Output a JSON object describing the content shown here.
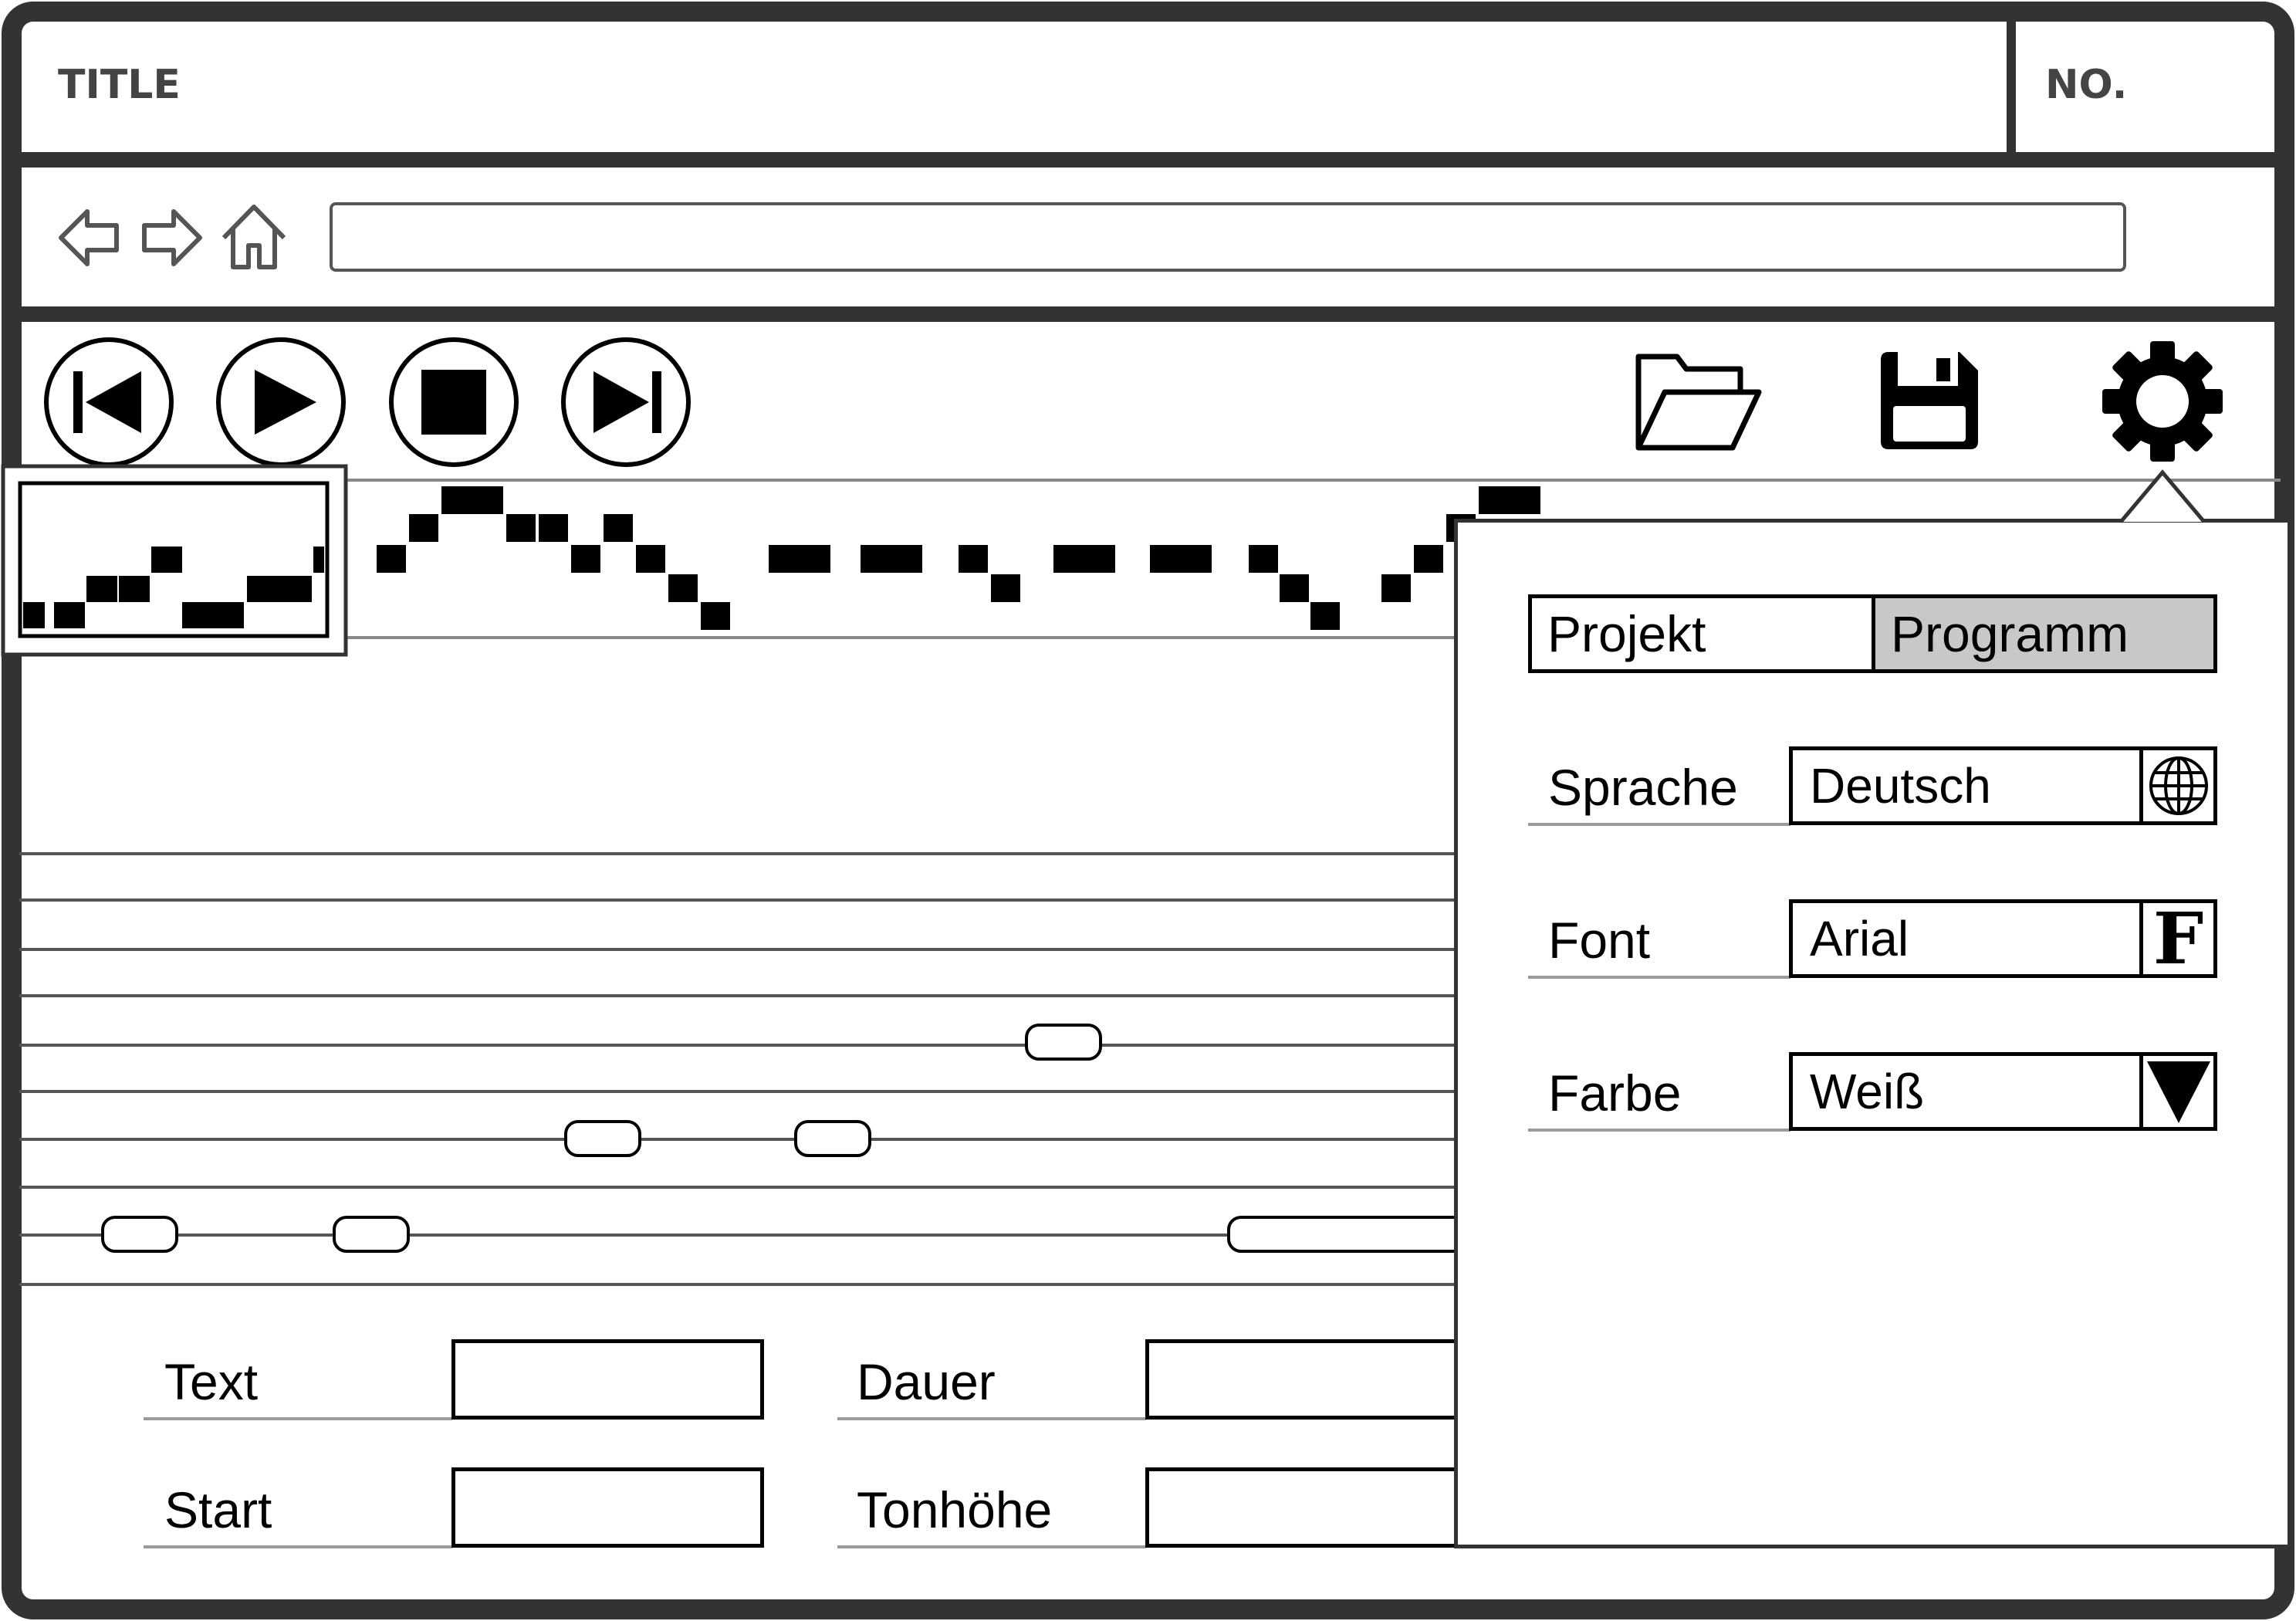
{
  "window": {
    "title": "TITLE",
    "number_label": "NO."
  },
  "navbar": {
    "back_icon": "arrow-left-outline-icon",
    "forward_icon": "arrow-right-outline-icon",
    "home_icon": "house-outline-icon",
    "address_value": ""
  },
  "toolbar": {
    "transport": [
      "skip-back-icon",
      "play-icon",
      "stop-icon",
      "skip-forward-icon"
    ],
    "actions": [
      "folder-open-icon",
      "save-disk-icon",
      "gear-icon"
    ]
  },
  "editor": {
    "fields": {
      "text_label": "Text",
      "text_value": "",
      "start_label": "Start",
      "start_value": "",
      "duration_label": "Dauer",
      "duration_value": "",
      "pitch_label": "Tonhöhe",
      "pitch_value": ""
    }
  },
  "settings_popup": {
    "tabs": [
      {
        "label": "Projekt",
        "active": false
      },
      {
        "label": "Programm",
        "active": true
      }
    ],
    "rows": [
      {
        "label": "Sprache",
        "value": "Deutsch",
        "icon": "globe-icon"
      },
      {
        "label": "Font",
        "value": "Arial",
        "icon": "font-f-icon",
        "icon_text": "F"
      },
      {
        "label": "Farbe",
        "value": "Weiß",
        "icon": "dropdown-triangle-icon"
      }
    ]
  },
  "colors": {
    "frame": "#333333",
    "active_tab": "#c8c8c8",
    "staff_line": "#555555",
    "text": "#000000"
  }
}
